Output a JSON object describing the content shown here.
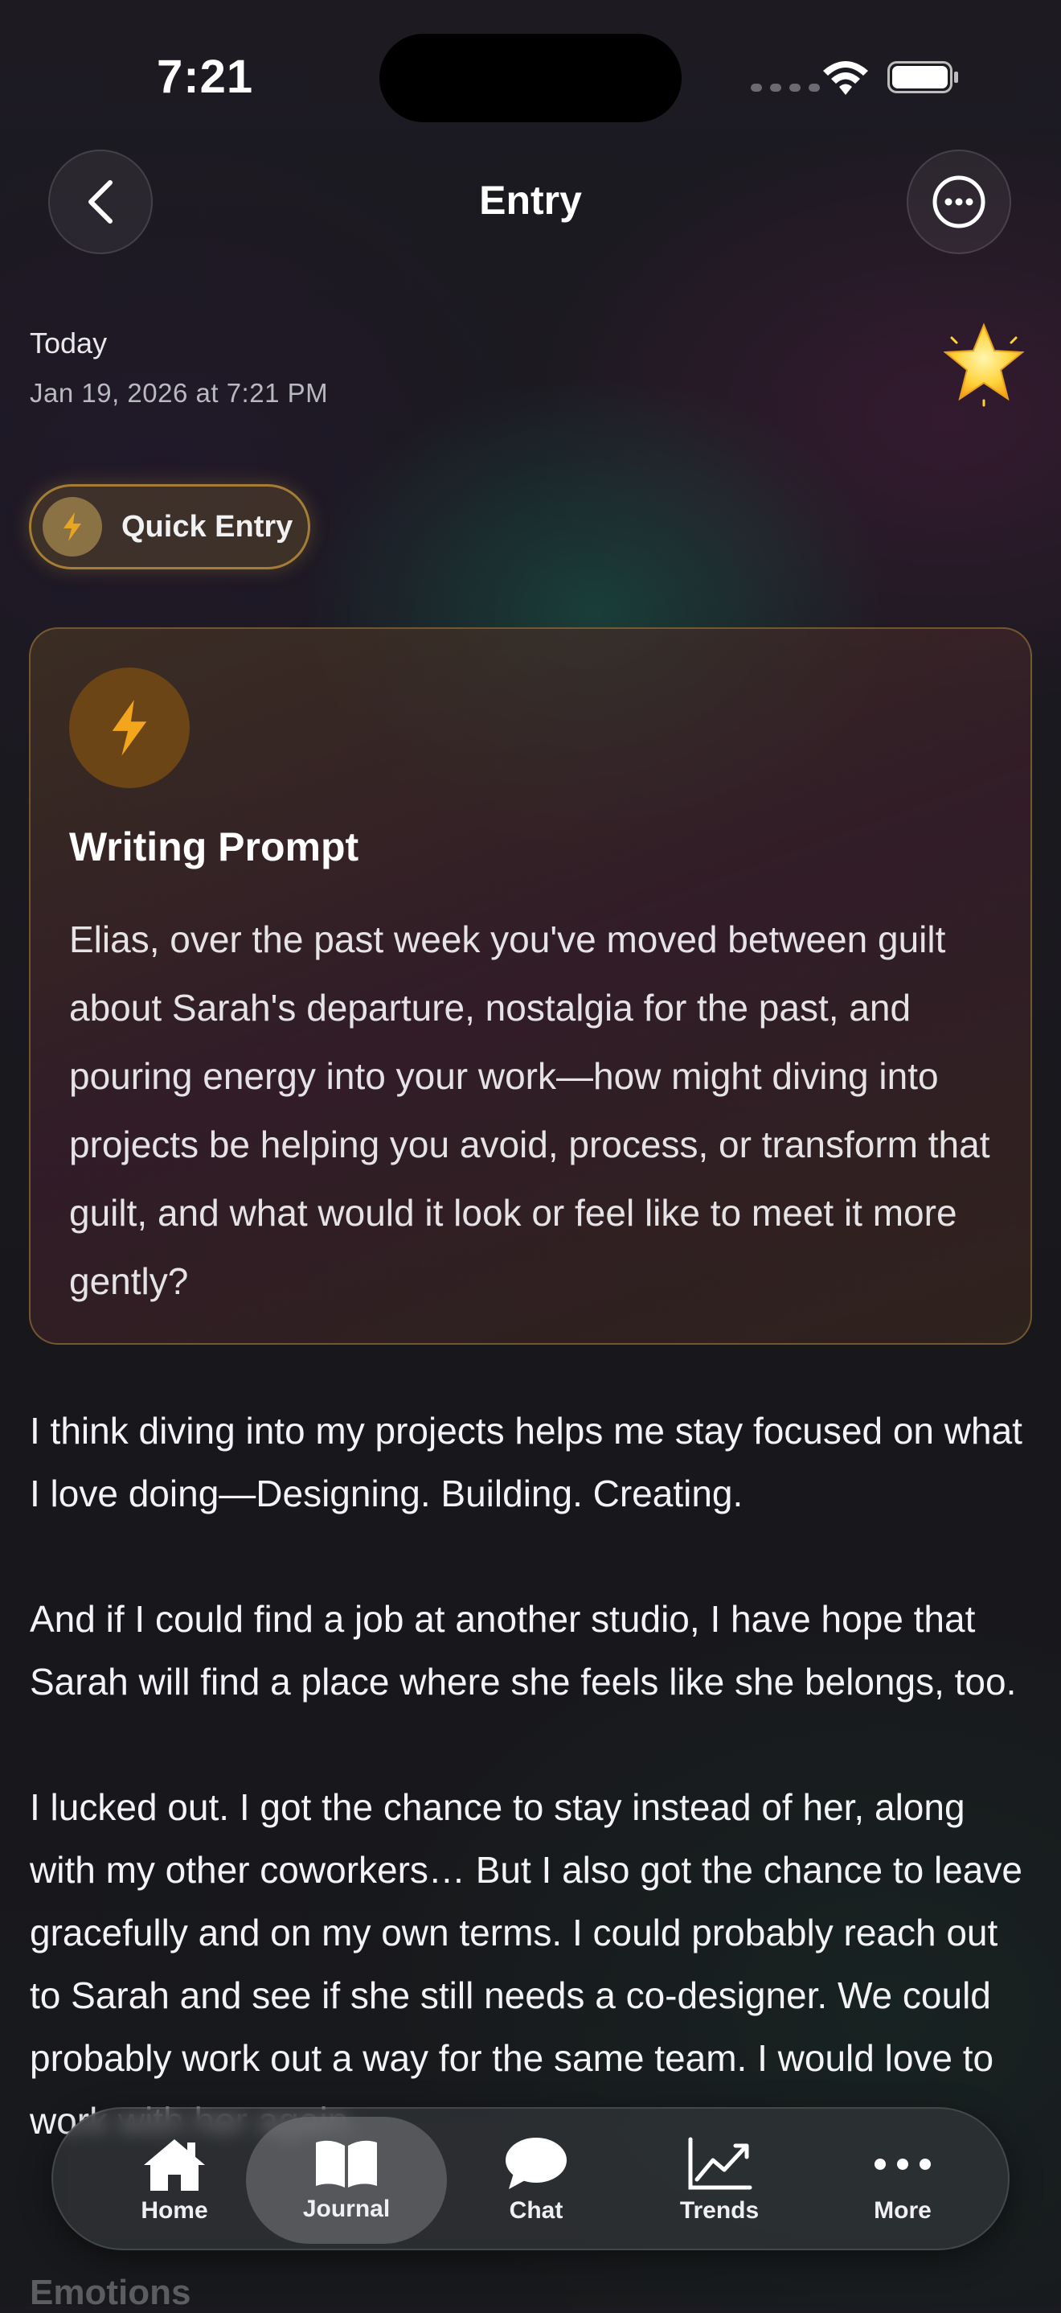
{
  "status_bar": {
    "time": "7:21"
  },
  "nav": {
    "title": "Entry",
    "back_icon": "chevron-left-icon",
    "more_icon": "ellipsis-circle-icon"
  },
  "entry": {
    "date_label": "Today",
    "date_detail": "Jan 19, 2026 at 7:21 PM",
    "mood_icon": "glowing-star-icon",
    "type_chip": "Quick Entry"
  },
  "prompt_card": {
    "title": "Writing Prompt",
    "text": "Elias, over the past week you've moved between guilt about Sarah's departure, nostalgia for the past, and pouring energy into your work—how might diving into projects be helping you avoid, process, or transform that guilt, and what would it look or feel like to meet it more gently?"
  },
  "body": {
    "paragraphs": [
      "I think diving into my projects helps me stay focused on what I love doing—Designing. Building. Creating.",
      "And if I could find a job at another studio, I have hope that Sarah will find a place where she feels like she belongs, too.",
      "I lucked out. I got the chance to stay instead of her, along with my other coworkers… But I also got the chance to leave gracefully and on my own terms. I could probably reach out to Sarah and see if she still needs a co-designer. We could probably work out a way for the same team. I would love to work with her again."
    ],
    "next_section": "Emotions"
  },
  "tab_bar": {
    "active": "Journal",
    "tabs": [
      {
        "label": "Home",
        "icon": "house-icon"
      },
      {
        "label": "Journal",
        "icon": "open-book-icon"
      },
      {
        "label": "Chat",
        "icon": "speech-bubble-icon"
      },
      {
        "label": "Trends",
        "icon": "chart-line-icon"
      },
      {
        "label": "More",
        "icon": "ellipsis-icon"
      }
    ]
  },
  "colors": {
    "accent": "#f3a51c",
    "chip_border": "#d2a03c",
    "background": "#1a1a20"
  }
}
